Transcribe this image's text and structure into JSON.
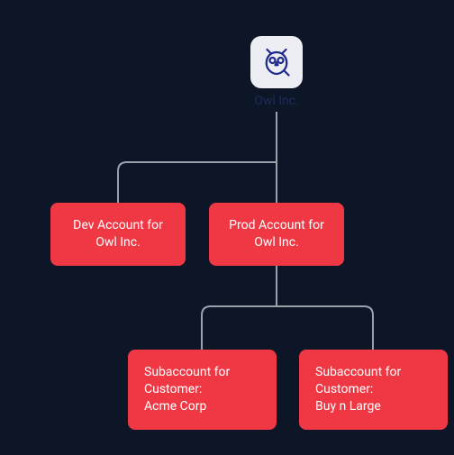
{
  "company": {
    "name": "Owl Inc.",
    "icon": "owl-icon"
  },
  "nodes": {
    "dev": {
      "label": "Dev Account for Owl Inc."
    },
    "prod": {
      "label": "Prod Account for Owl Inc."
    },
    "sub_acme": {
      "line1": "Subaccount for",
      "line2": "Customer:",
      "line3": "Acme Corp"
    },
    "sub_bnl": {
      "line1": "Subaccount for",
      "line2": "Customer:",
      "line3": "Buy n Large"
    }
  },
  "chart_data": {
    "type": "tree",
    "root": "Owl Inc.",
    "children": [
      {
        "name": "Dev Account for Owl Inc."
      },
      {
        "name": "Prod Account for Owl Inc.",
        "children": [
          {
            "name": "Subaccount for Customer: Acme Corp"
          },
          {
            "name": "Subaccount for Customer: Buy n Large"
          }
        ]
      }
    ]
  }
}
